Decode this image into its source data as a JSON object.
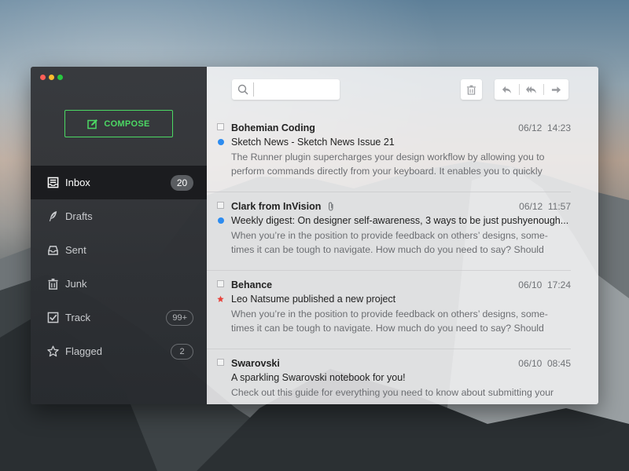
{
  "sidebar": {
    "compose_label": "COMPOSE",
    "items": [
      {
        "label": "Inbox",
        "badge": "20",
        "icon": "inbox-icon"
      },
      {
        "label": "Drafts",
        "badge": "",
        "icon": "feather-icon"
      },
      {
        "label": "Sent",
        "badge": "",
        "icon": "sent-tray-icon"
      },
      {
        "label": "Junk",
        "badge": "",
        "icon": "trash-icon"
      },
      {
        "label": "Track",
        "badge": "99+",
        "icon": "checkbox-icon"
      },
      {
        "label": "Flagged",
        "badge": "2",
        "icon": "star-icon"
      }
    ]
  },
  "toolbar": {
    "search_placeholder": "",
    "icons": [
      "search-icon",
      "trash-icon",
      "reply-icon",
      "reply-all-icon",
      "forward-icon"
    ]
  },
  "colors": {
    "accent": "#4cd964",
    "unread": "#2d8cf0",
    "star": "#e8413a"
  },
  "messages": [
    {
      "sender": "Bohemian Coding",
      "date": "06/12",
      "time": "14:23",
      "marker": "unread",
      "attachment": false,
      "subject": "Sketch News - Sketch News Issue 21",
      "preview_1": "The Runner plugin supercharges your design workflow by allowing you to",
      "preview_2": "perform commands directly from your keyboard. It enables you to quickly"
    },
    {
      "sender": "Clark from InVision",
      "date": "06/12",
      "time": "11:57",
      "marker": "unread",
      "attachment": true,
      "subject": "Weekly digest: On designer self-awareness, 3 ways to be just pushyenough...",
      "preview_1": "When you’re in the position to provide feedback on others’ designs, some-",
      "preview_2": "times it can be tough to navigate. How much do you need to say? Should"
    },
    {
      "sender": "Behance",
      "date": "06/10",
      "time": "17:24",
      "marker": "starred",
      "attachment": false,
      "subject": "Leo Natsume published a new project",
      "preview_1": "When you’re in the position to provide feedback on others’ designs, some-",
      "preview_2": "times it can be tough to navigate. How much do you need to say? Should"
    },
    {
      "sender": "Swarovski",
      "date": "06/10",
      "time": "08:45",
      "marker": "none",
      "attachment": false,
      "subject": "A sparkling Swarovski notebook for you!",
      "preview_1": "Check out this guide for everything you need to know about submitting your",
      "preview_2": ""
    }
  ]
}
